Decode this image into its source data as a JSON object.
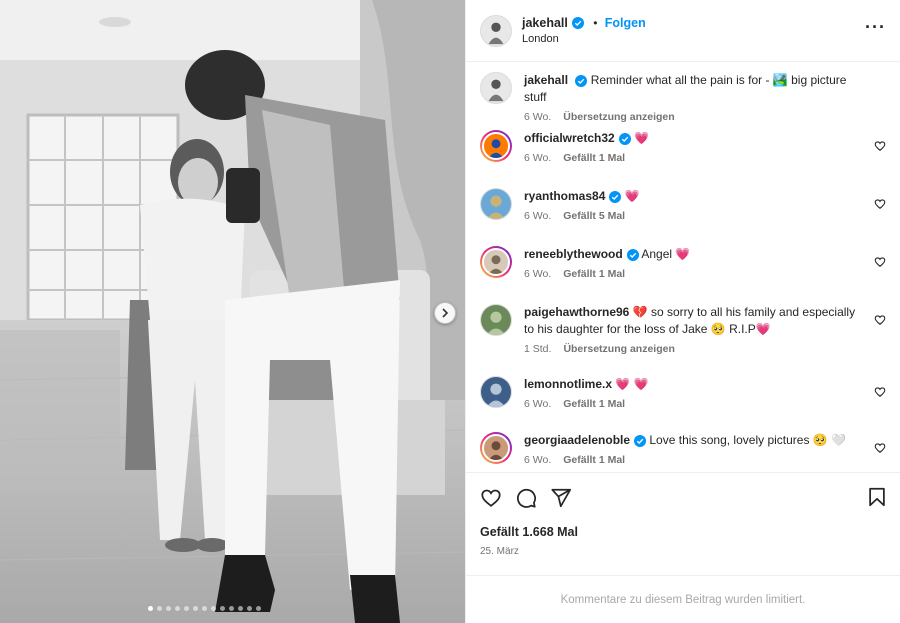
{
  "post": {
    "author": "jakehall",
    "location": "London",
    "follow_label": "Folgen",
    "separator": "•",
    "more_icon": "more-horizontal-icon",
    "photo": {
      "slide_count": 13,
      "active_slide": 1,
      "next_icon": "chevron-right-icon"
    }
  },
  "caption": {
    "username": "jakehall",
    "text_before_emoji": "Reminder what all the pain is for -",
    "emoji": "🏞️",
    "text_after_emoji": "big picture stuff",
    "time": "6 Wo.",
    "translate_label": "Übersetzung anzeigen"
  },
  "comments": [
    {
      "username": "officialwretch32",
      "verified": true,
      "text": "",
      "emoji": "💗",
      "time": "6 Wo.",
      "likes_label": "Gefällt 1 Mal"
    },
    {
      "username": "ryanthomas84",
      "verified": true,
      "text": "",
      "emoji": "💗",
      "time": "6 Wo.",
      "likes_label": "Gefällt 5 Mal"
    },
    {
      "username": "reneeblythewood",
      "verified": true,
      "text": "Angel",
      "emoji": "💗",
      "time": "6 Wo.",
      "likes_label": "Gefällt 1 Mal"
    },
    {
      "username": "paigehawthorne96",
      "verified": false,
      "emoji_before": "💔",
      "text": "so sorry to all his family and especially to his daughter for the loss of Jake",
      "emoji_mid": "🥺",
      "text_after": "R.I.P",
      "emoji": "💗",
      "time": "1 Std.",
      "likes_label": "Übersetzung anzeigen"
    },
    {
      "username": "lemonnotlime.x",
      "verified": false,
      "text": "",
      "emoji": "💗 💗",
      "time": "6 Wo.",
      "likes_label": "Gefällt 1 Mal"
    },
    {
      "username": "georgiaadelenoble",
      "verified": true,
      "text": "Love this song, lovely pictures",
      "emoji": "🥺 🤍",
      "time": "6 Wo.",
      "likes_label": "Gefällt 1 Mal"
    }
  ],
  "actions": {
    "like_icon": "heart-icon",
    "comment_icon": "comment-icon",
    "share_icon": "send-icon",
    "save_icon": "bookmark-icon",
    "likes": "Gefällt 1.668 Mal",
    "date": "25. März"
  },
  "footer": {
    "limited_text": "Kommentare zu diesem Beitrag wurden limitiert."
  },
  "colors": {
    "accent": "#0095f6",
    "verified": "#0095f6",
    "heart": "#ed2553",
    "muted": "#737373"
  }
}
